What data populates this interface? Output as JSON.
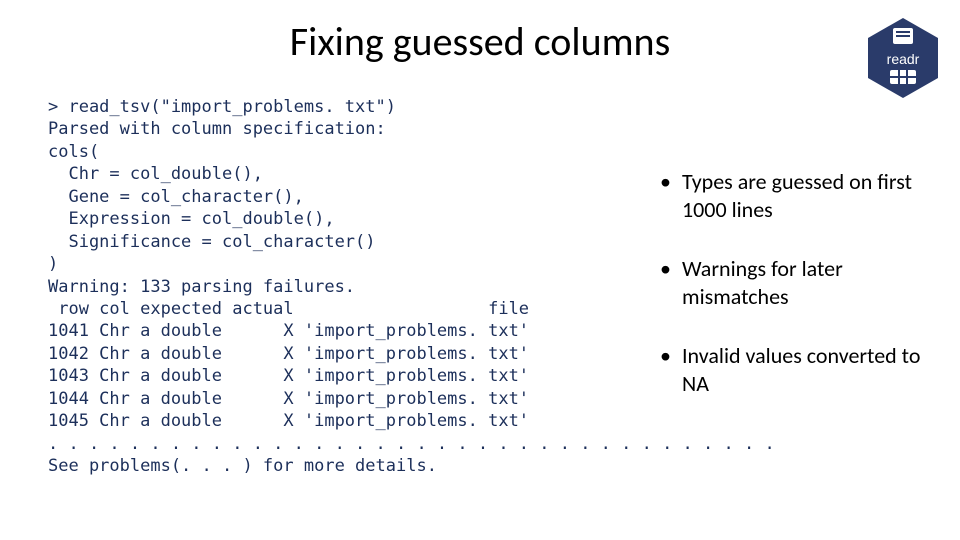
{
  "title": "Fixing guessed columns",
  "logo": {
    "label": "readr"
  },
  "code": {
    "prompt": "> read_tsv(\"import_problems. txt\")",
    "parsed": "Parsed with column specification:",
    "cols_open": "cols(",
    "col1": "  Chr = col_double(),",
    "col2": "  Gene = col_character(),",
    "col3": "  Expression = col_double(),",
    "col4": "  Significance = col_character()",
    "cols_close": ")",
    "warning": "Warning: 133 parsing failures.",
    "hdr": " row col expected actual                   file",
    "r1": "1041 Chr a double      X 'import_problems. txt'",
    "r2": "1042 Chr a double      X 'import_problems. txt'",
    "r3": "1043 Chr a double      X 'import_problems. txt'",
    "r4": "1044 Chr a double      X 'import_problems. txt'",
    "r5": "1045 Chr a double      X 'import_problems. txt'",
    "dots": ". . . . . . . . . . . . . . . . . . . . . . . . . . . . . . . . . . . .",
    "see": "See problems(. . . ) for more details."
  },
  "bullets": {
    "items": [
      {
        "text": "Types are guessed on first 1000 lines"
      },
      {
        "text": "Warnings for later mismatches"
      },
      {
        "text": "Invalid values converted to NA"
      }
    ]
  }
}
